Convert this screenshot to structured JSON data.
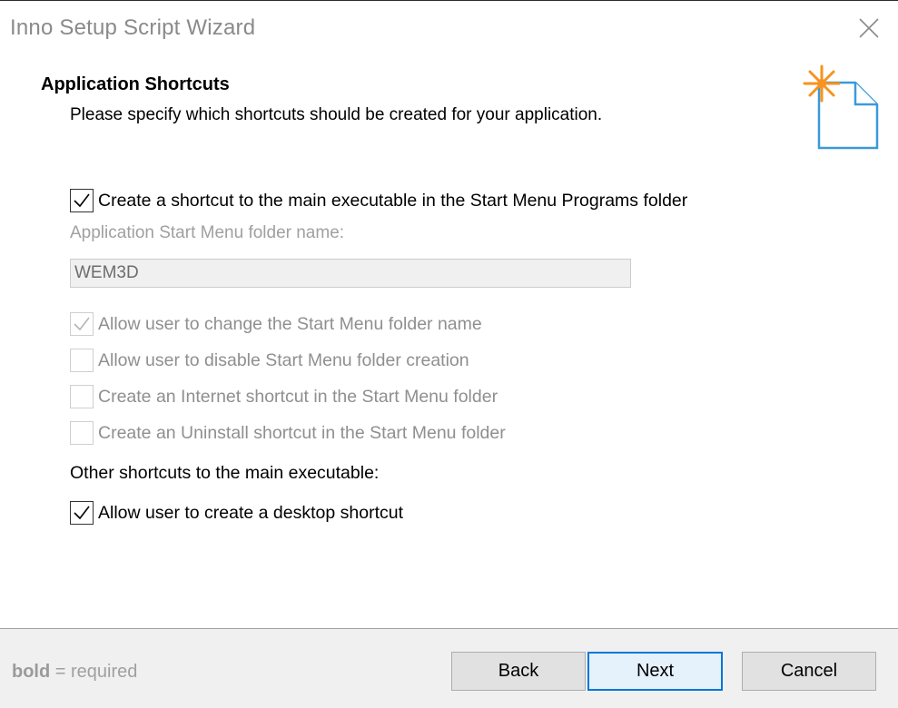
{
  "window": {
    "title": "Inno Setup Script Wizard"
  },
  "header": {
    "title": "Application Shortcuts",
    "subtitle": "Please specify which shortcuts should be created for your application."
  },
  "options": {
    "create_start_menu_shortcut": {
      "label": "Create a shortcut to the main executable in the Start Menu Programs folder",
      "checked": true,
      "enabled": true
    },
    "folder_name_label": "Application Start Menu folder name:",
    "folder_name_value": "WEM3D",
    "allow_change_folder": {
      "label": "Allow user to change the Start Menu folder name",
      "checked": true,
      "enabled": false
    },
    "allow_disable_folder": {
      "label": "Allow user to disable Start Menu folder creation",
      "checked": false,
      "enabled": false
    },
    "internet_shortcut": {
      "label": "Create an Internet shortcut in the Start Menu folder",
      "checked": false,
      "enabled": false
    },
    "uninstall_shortcut": {
      "label": "Create an Uninstall shortcut in the Start Menu folder",
      "checked": false,
      "enabled": false
    },
    "other_shortcuts_label": "Other shortcuts to the main executable:",
    "desktop_shortcut": {
      "label": "Allow user to create a desktop shortcut",
      "checked": true,
      "enabled": true
    }
  },
  "footer": {
    "note_bold": "bold",
    "note_rest": " = required",
    "back_label": "Back",
    "next_label": "Next",
    "cancel_label": "Cancel"
  },
  "icons": {
    "close": "close-icon",
    "header": "new-document-icon",
    "check": "checkmark-icon"
  },
  "colors": {
    "accent": "#0078d7",
    "spark": "#f7931e",
    "doc_outline": "#3a9ad9"
  }
}
